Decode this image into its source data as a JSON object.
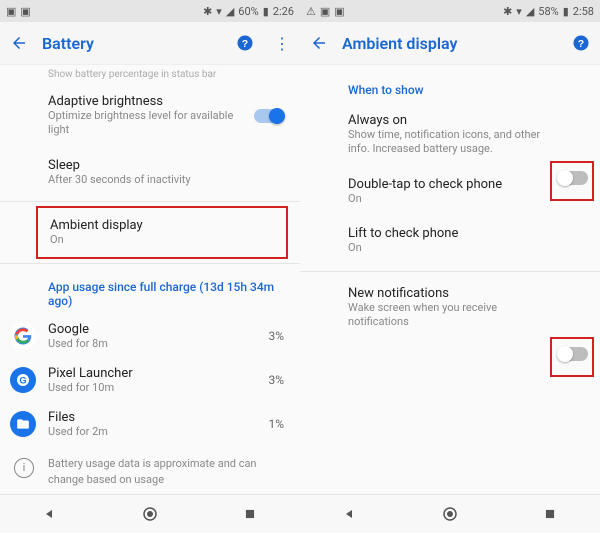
{
  "left": {
    "status": {
      "battery": "60%",
      "time": "2:26"
    },
    "title": "Battery",
    "faded_top": "Show battery percentage in status bar",
    "adaptive": {
      "label": "Adaptive brightness",
      "sub": "Optimize brightness level for available light"
    },
    "sleep": {
      "label": "Sleep",
      "sub": "After 30 seconds of inactivity"
    },
    "ambient": {
      "label": "Ambient display",
      "sub": "On"
    },
    "usage_header": "App usage since full charge (13d 15h 34m ago)",
    "apps": [
      {
        "label": "Google",
        "sub": "Used for 8m",
        "pct": "3%"
      },
      {
        "label": "Pixel Launcher",
        "sub": "Used for 10m",
        "pct": "3%"
      },
      {
        "label": "Files",
        "sub": "Used for 2m",
        "pct": "1%"
      }
    ],
    "note": "Battery usage data is approximate and can change based on usage"
  },
  "right": {
    "status": {
      "battery": "58%",
      "time": "2:58"
    },
    "title": "Ambient display",
    "section": "When to show",
    "always": {
      "label": "Always on",
      "sub": "Show time, notification icons, and other info. Increased battery usage."
    },
    "doubletap": {
      "label": "Double-tap to check phone",
      "sub": "On"
    },
    "lift": {
      "label": "Lift to check phone",
      "sub": "On"
    },
    "newnotif": {
      "label": "New notifications",
      "sub": "Wake screen when you receive notifications"
    }
  }
}
